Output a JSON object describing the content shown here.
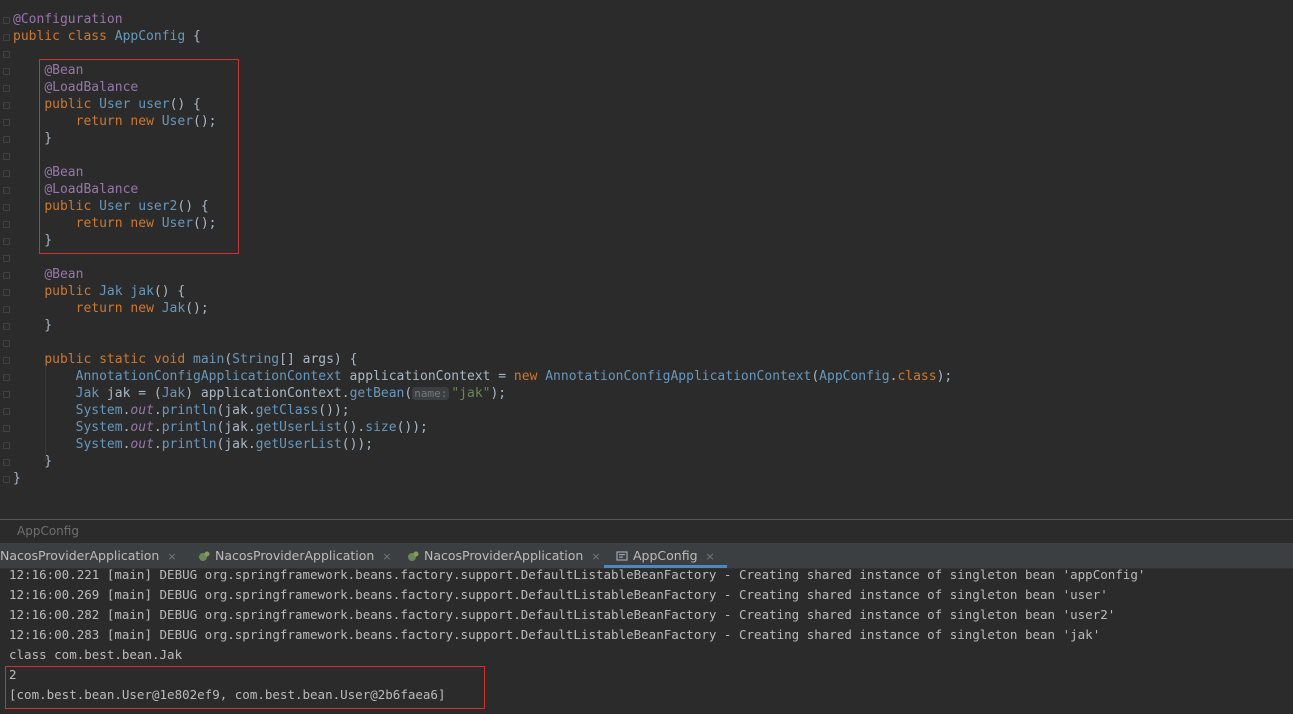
{
  "editor": {
    "lines": [
      {
        "parts": [
          [
            "an2",
            "@Configuration"
          ]
        ]
      },
      {
        "parts": [
          [
            "kw",
            "public class "
          ],
          [
            "ty",
            "AppConfig"
          ],
          [
            "",
            " {"
          ]
        ]
      },
      {
        "parts": [
          [
            "",
            ""
          ]
        ]
      },
      {
        "parts": [
          [
            "",
            "    "
          ],
          [
            "an2",
            "@Bean"
          ]
        ]
      },
      {
        "parts": [
          [
            "",
            "    "
          ],
          [
            "an2",
            "@LoadBalance"
          ]
        ]
      },
      {
        "parts": [
          [
            "",
            "    "
          ],
          [
            "kw",
            "public "
          ],
          [
            "ty",
            "User "
          ],
          [
            "cls",
            "user"
          ],
          [
            "",
            "() {"
          ]
        ]
      },
      {
        "parts": [
          [
            "",
            "        "
          ],
          [
            "kw",
            "return new "
          ],
          [
            "ty",
            "User"
          ],
          [
            "",
            "();"
          ]
        ]
      },
      {
        "parts": [
          [
            "",
            "    }"
          ]
        ]
      },
      {
        "parts": [
          [
            "",
            ""
          ]
        ]
      },
      {
        "parts": [
          [
            "",
            "    "
          ],
          [
            "an2",
            "@Bean"
          ]
        ]
      },
      {
        "parts": [
          [
            "",
            "    "
          ],
          [
            "an2",
            "@LoadBalance"
          ]
        ]
      },
      {
        "parts": [
          [
            "",
            "    "
          ],
          [
            "kw",
            "public "
          ],
          [
            "ty",
            "User "
          ],
          [
            "cls",
            "user2"
          ],
          [
            "",
            "() {"
          ]
        ]
      },
      {
        "parts": [
          [
            "",
            "        "
          ],
          [
            "kw",
            "return new "
          ],
          [
            "ty",
            "User"
          ],
          [
            "",
            "();"
          ]
        ]
      },
      {
        "parts": [
          [
            "",
            "    }"
          ]
        ]
      },
      {
        "parts": [
          [
            "",
            ""
          ]
        ]
      },
      {
        "parts": [
          [
            "",
            "    "
          ],
          [
            "an2",
            "@Bean"
          ]
        ]
      },
      {
        "parts": [
          [
            "",
            "    "
          ],
          [
            "kw",
            "public "
          ],
          [
            "ty",
            "Jak "
          ],
          [
            "cls",
            "jak"
          ],
          [
            "",
            "() {"
          ]
        ]
      },
      {
        "parts": [
          [
            "",
            "        "
          ],
          [
            "kw",
            "return new "
          ],
          [
            "ty",
            "Jak"
          ],
          [
            "",
            "();"
          ]
        ]
      },
      {
        "parts": [
          [
            "",
            "    }"
          ]
        ]
      },
      {
        "parts": [
          [
            "",
            ""
          ]
        ]
      },
      {
        "parts": [
          [
            "",
            "    "
          ],
          [
            "kw",
            "public static void "
          ],
          [
            "cls",
            "main"
          ],
          [
            "",
            "("
          ],
          [
            "ty",
            "String"
          ],
          [
            "",
            "[] args) {"
          ]
        ]
      },
      {
        "parts": [
          [
            "",
            "        "
          ],
          [
            "ty",
            "AnnotationConfigApplicationContext"
          ],
          [
            "",
            " applicationContext = "
          ],
          [
            "kw",
            "new "
          ],
          [
            "ty",
            "AnnotationConfigApplicationContext"
          ],
          [
            "",
            "("
          ],
          [
            "ty",
            "AppConfig"
          ],
          [
            "",
            "."
          ],
          [
            "kw",
            "class"
          ],
          [
            "",
            ");"
          ]
        ]
      },
      {
        "parts": [
          [
            "",
            "        "
          ],
          [
            "ty",
            "Jak"
          ],
          [
            "",
            " jak = ("
          ],
          [
            "ty",
            "Jak"
          ],
          [
            "",
            ") applicationContext."
          ],
          [
            "cls",
            "getBean"
          ],
          [
            "",
            "("
          ],
          [
            "hint",
            "name:"
          ],
          [
            "st",
            "\"jak\""
          ],
          [
            "",
            ");"
          ]
        ]
      },
      {
        "parts": [
          [
            "",
            "        "
          ],
          [
            "ty",
            "System"
          ],
          [
            "",
            "."
          ],
          [
            "it",
            "out"
          ],
          [
            "",
            "."
          ],
          [
            "cls",
            "println"
          ],
          [
            "",
            "(jak."
          ],
          [
            "cls",
            "getClass"
          ],
          [
            "",
            "());"
          ]
        ]
      },
      {
        "parts": [
          [
            "",
            "        "
          ],
          [
            "ty",
            "System"
          ],
          [
            "",
            "."
          ],
          [
            "it",
            "out"
          ],
          [
            "",
            "."
          ],
          [
            "cls",
            "println"
          ],
          [
            "",
            "(jak."
          ],
          [
            "cls",
            "getUserList"
          ],
          [
            "",
            "()."
          ],
          [
            "cls",
            "size"
          ],
          [
            "",
            "());"
          ]
        ]
      },
      {
        "parts": [
          [
            "",
            "        "
          ],
          [
            "ty",
            "System"
          ],
          [
            "",
            "."
          ],
          [
            "it",
            "out"
          ],
          [
            "",
            "."
          ],
          [
            "cls",
            "println"
          ],
          [
            "",
            "(jak."
          ],
          [
            "cls",
            "getUserList"
          ],
          [
            "",
            "());"
          ]
        ]
      },
      {
        "parts": [
          [
            "",
            "    }"
          ]
        ]
      },
      {
        "parts": [
          [
            "",
            "}"
          ]
        ]
      }
    ]
  },
  "breadcrumb": {
    "label": "AppConfig"
  },
  "run_tabs": [
    {
      "label": "NacosProviderApplication",
      "close": "×",
      "icon": "spring-icon"
    },
    {
      "label": "NacosProviderApplication",
      "close": "×",
      "icon": "spring-icon"
    },
    {
      "label": "NacosProviderApplication",
      "close": "×",
      "icon": "spring-icon"
    },
    {
      "label": "AppConfig",
      "close": "×",
      "icon": "run-config-icon",
      "active": true
    }
  ],
  "console": {
    "lines": [
      "12:16:00.221 [main] DEBUG org.springframework.beans.factory.support.DefaultListableBeanFactory - Creating shared instance of singleton bean 'appConfig'",
      "12:16:00.269 [main] DEBUG org.springframework.beans.factory.support.DefaultListableBeanFactory - Creating shared instance of singleton bean 'user'",
      "12:16:00.282 [main] DEBUG org.springframework.beans.factory.support.DefaultListableBeanFactory - Creating shared instance of singleton bean 'user2'",
      "12:16:00.283 [main] DEBUG org.springframework.beans.factory.support.DefaultListableBeanFactory - Creating shared instance of singleton bean 'jak'",
      "class com.best.bean.Jak",
      "2",
      "[com.best.bean.User@1e802ef9, com.best.bean.User@2b6faea6]"
    ]
  },
  "colors": {
    "highlight_box": "#d32f2f",
    "active_tab_underline": "#4a88c7"
  }
}
